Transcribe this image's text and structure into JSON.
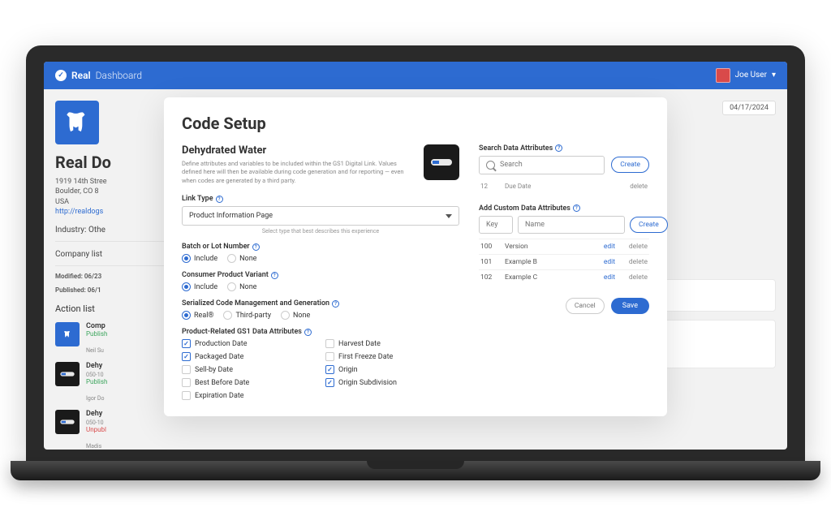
{
  "topbar": {
    "brand_main": "Real",
    "brand_reg": "®",
    "brand_sub": "Dashboard",
    "user_name": "Joe User"
  },
  "sidebar": {
    "company_name": "Real Do",
    "address_line1": "1919 14th Stree",
    "address_line2": "Boulder, CO 8",
    "address_line3": "USA",
    "website": "http://realdogs",
    "industry_label": "Industry: Othe",
    "company_listings_label": "Company list",
    "modified": "Modified: 06/23",
    "published": "Published: 06/1",
    "action_list_label": "Action list",
    "items": [
      {
        "title": "Comp",
        "sub": "",
        "status": "Publish",
        "status_class": "pub",
        "author": "Neil Su",
        "thumb": "logo"
      },
      {
        "title": "Dehy",
        "sub": "050-10",
        "status": "Publish",
        "status_class": "pub",
        "author": "Igor Do",
        "thumb": "product"
      },
      {
        "title": "Dehy",
        "sub": "050-10",
        "status": "Unpubl",
        "status_class": "unpub",
        "author": "Madis",
        "thumb": "product"
      }
    ]
  },
  "background": {
    "date": "04/17/2024"
  },
  "modal": {
    "title": "Code Setup",
    "product_name": "Dehydrated Water",
    "product_desc": "Define attributes and variables to be included within the GS1 Digital Link. Values defined here will then be available during code generation and for reporting — even when codes are generated by a third party.",
    "link_type_label": "Link Type",
    "link_type_value": "Product Information Page",
    "link_type_hint": "Select type that best describes this experience",
    "batch_label": "Batch or Lot Number",
    "variant_label": "Consumer Product Variant",
    "serialized_label": "Serialized Code Management and Generation",
    "gs1_label": "Product-Related GS1 Data Attributes",
    "radio_opts": {
      "include": "Include",
      "none": "None",
      "real": "Real®",
      "third_party": "Third-party"
    },
    "gs1_attrs": [
      {
        "label": "Production Date",
        "checked": true
      },
      {
        "label": "Harvest Date",
        "checked": false
      },
      {
        "label": "Packaged Date",
        "checked": true
      },
      {
        "label": "First Freeze Date",
        "checked": false
      },
      {
        "label": "Sell-by Date",
        "checked": false
      },
      {
        "label": "Origin",
        "checked": true
      },
      {
        "label": "Best Before Date",
        "checked": false
      },
      {
        "label": "Origin Subdivision",
        "checked": true
      },
      {
        "label": "Expiration Date",
        "checked": false
      }
    ],
    "search_label": "Search Data Attributes",
    "search_placeholder": "Search",
    "create_label": "Create",
    "search_header_col1": "12",
    "search_header_col2": "Due Date",
    "search_header_col3": "delete",
    "custom_label": "Add Custom Data Attributes",
    "key_placeholder": "Key",
    "name_placeholder": "Name",
    "custom_rows": [
      {
        "id": "100",
        "name": "Version",
        "edit": "edit",
        "delete": "delete"
      },
      {
        "id": "101",
        "name": "Example B",
        "edit": "edit",
        "delete": "delete"
      },
      {
        "id": "102",
        "name": "Example C",
        "edit": "edit",
        "delete": "delete"
      }
    ],
    "cancel_label": "Cancel",
    "save_label": "Save"
  }
}
